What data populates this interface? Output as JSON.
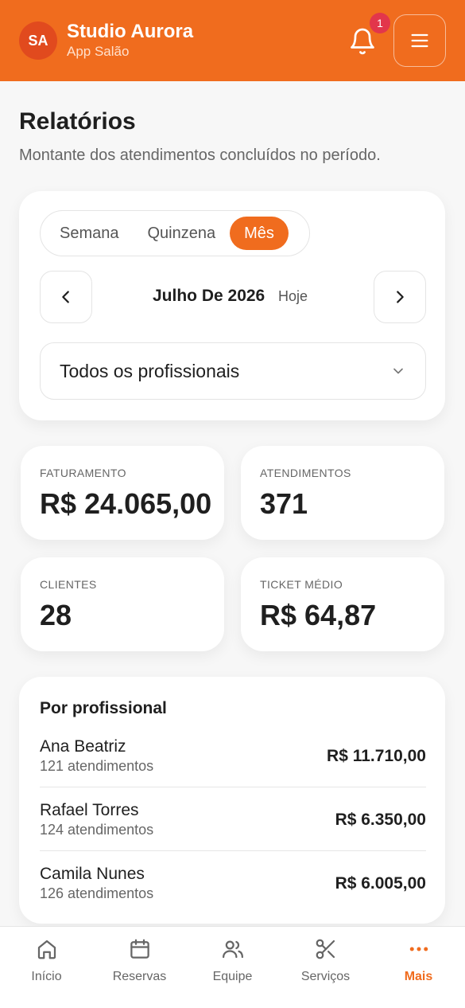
{
  "header": {
    "avatar_initials": "SA",
    "title": "Studio Aurora",
    "subtitle": "App Salão",
    "notification_count": "1",
    "accent_color": "#f06c1e"
  },
  "page": {
    "title": "Relatórios",
    "subtitle": "Montante dos atendimentos concluídos no período."
  },
  "filters": {
    "segments": [
      "Semana",
      "Quinzena",
      "Mês"
    ],
    "selected_segment": "Mês",
    "period_label": "Julho De 2026",
    "today_label": "Hoje",
    "professional_select": "Todos os profissionais"
  },
  "stats": [
    {
      "label": "FATURAMENTO",
      "value": "R$ 24.065,00"
    },
    {
      "label": "ATENDIMENTOS",
      "value": "371"
    },
    {
      "label": "CLIENTES",
      "value": "28"
    },
    {
      "label": "TICKET MÉDIO",
      "value": "R$ 64,87"
    }
  ],
  "by_professional": {
    "title": "Por profissional",
    "rows": [
      {
        "name": "Ana Beatriz",
        "count": "121 atendimentos",
        "amount": "R$ 11.710,00"
      },
      {
        "name": "Rafael Torres",
        "count": "124 atendimentos",
        "amount": "R$ 6.350,00"
      },
      {
        "name": "Camila Nunes",
        "count": "126 atendimentos",
        "amount": "R$ 6.005,00"
      }
    ]
  },
  "bottom_nav": [
    {
      "label": "Início",
      "icon": "home-icon"
    },
    {
      "label": "Reservas",
      "icon": "calendar-icon"
    },
    {
      "label": "Equipe",
      "icon": "users-icon"
    },
    {
      "label": "Serviços",
      "icon": "scissors-icon"
    },
    {
      "label": "Mais",
      "icon": "more-icon",
      "active": true
    }
  ]
}
